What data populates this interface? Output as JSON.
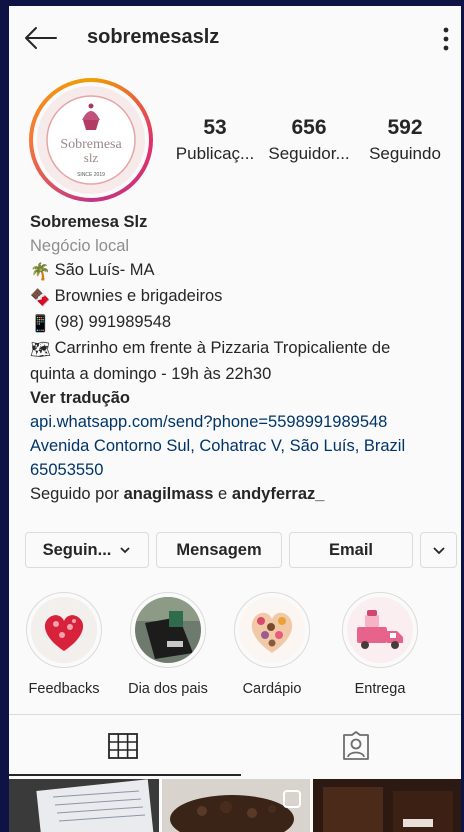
{
  "header": {
    "username": "sobremesaslz"
  },
  "avatar": {
    "logo_text_1": "Sobremesa",
    "logo_text_2": "slz",
    "logo_since": "SINCE 2019"
  },
  "stats": [
    {
      "value": "53",
      "label": "Publicaç..."
    },
    {
      "value": "656",
      "label": "Seguidor..."
    },
    {
      "value": "592",
      "label": "Seguindo"
    }
  ],
  "bio": {
    "name": "Sobremesa Slz",
    "category": "Negócio local",
    "lines": [
      {
        "emoji": "🌴",
        "text": "São Luís- MA"
      },
      {
        "emoji": "🍫",
        "text": "Brownies e brigadeiros"
      },
      {
        "emoji": "📱",
        "text": "(98) 991989548"
      },
      {
        "emoji": "🗺",
        "text": "Carrinho em frente à Pizzaria Tropicaliente de"
      }
    ],
    "continuation": "quinta a domingo - 19h às 22h30",
    "translate": "Ver tradução",
    "link_1": "api.whatsapp.com/send?phone=5598991989548",
    "link_2": "Avenida Contorno Sul, Cohatrac V, São Luís, Brazil",
    "link_3": "65053550",
    "followed_prefix": "Seguido por ",
    "followed_user_1": "anagilmass",
    "followed_joiner": " e ",
    "followed_user_2": "andyferraz_"
  },
  "buttons": {
    "following": "Seguin...",
    "message": "Mensagem",
    "email": "Email"
  },
  "highlights": [
    {
      "label": "Feedbacks"
    },
    {
      "label": "Dia dos pais"
    },
    {
      "label": "Cardápio"
    },
    {
      "label": "Entrega"
    }
  ],
  "colors": {
    "accent_link": "#003569",
    "border": "#dbdbdb",
    "page_bg": "#0e1244"
  }
}
